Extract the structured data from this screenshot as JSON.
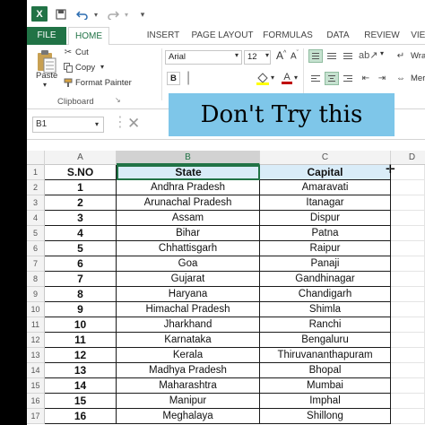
{
  "qat": {
    "logo": "X",
    "undo_icon": "undo-icon",
    "redo_icon": "redo-icon"
  },
  "tabs": [
    {
      "label": "FILE"
    },
    {
      "label": "HOME"
    },
    {
      "label": "INSERT"
    },
    {
      "label": "PAGE LAYOUT"
    },
    {
      "label": "FORMULAS"
    },
    {
      "label": "DATA"
    },
    {
      "label": "REVIEW"
    },
    {
      "label": "VIEW"
    }
  ],
  "ribbon": {
    "cut": "Cut",
    "copy": "Copy",
    "format_painter": "Format Painter",
    "paste": "Paste",
    "clipboard": "Clipboard",
    "font_name": "Arial",
    "font_size": "12",
    "bold": "B",
    "wrap_text": "Wrap Text",
    "merge": "Merge & C"
  },
  "formula_bar": {
    "name_box": "B1"
  },
  "overlay_text": "Don't Try this",
  "columns": [
    "A",
    "B",
    "C",
    "D"
  ],
  "header": {
    "sno": "S.NO",
    "state": "State",
    "capital": "Capital"
  },
  "rows": [
    {
      "n": "1",
      "sno": "1",
      "state": "Andhra Pradesh",
      "capital": "Amaravati"
    },
    {
      "n": "2",
      "sno": "2",
      "state": "Arunachal Pradesh",
      "capital": "Itanagar"
    },
    {
      "n": "3",
      "sno": "3",
      "state": "Assam",
      "capital": "Dispur"
    },
    {
      "n": "4",
      "sno": "4",
      "state": "Bihar",
      "capital": "Patna"
    },
    {
      "n": "5",
      "sno": "5",
      "state": "Chhattisgarh",
      "capital": "Raipur"
    },
    {
      "n": "6",
      "sno": "6",
      "state": "Goa",
      "capital": "Panaji"
    },
    {
      "n": "7",
      "sno": "7",
      "state": "Gujarat",
      "capital": "Gandhinagar"
    },
    {
      "n": "8",
      "sno": "8",
      "state": "Haryana",
      "capital": "Chandigarh"
    },
    {
      "n": "9",
      "sno": "9",
      "state": "Himachal Pradesh",
      "capital": "Shimla"
    },
    {
      "n": "10",
      "sno": "10",
      "state": "Jharkhand",
      "capital": "Ranchi"
    },
    {
      "n": "11",
      "sno": "11",
      "state": "Karnataka",
      "capital": "Bengaluru"
    },
    {
      "n": "12",
      "sno": "12",
      "state": "Kerala",
      "capital": "Thiruvananthapuram"
    },
    {
      "n": "13",
      "sno": "13",
      "state": "Madhya Pradesh",
      "capital": "Bhopal"
    },
    {
      "n": "14",
      "sno": "14",
      "state": "Maharashtra",
      "capital": "Mumbai"
    },
    {
      "n": "15",
      "sno": "15",
      "state": "Manipur",
      "capital": "Imphal"
    },
    {
      "n": "16",
      "sno": "16",
      "state": "Meghalaya",
      "capital": "Shillong"
    }
  ],
  "row_numbers": [
    "1",
    "2",
    "3",
    "4",
    "5",
    "6",
    "7",
    "8",
    "9",
    "10",
    "11",
    "12",
    "13",
    "14",
    "15",
    "16",
    "17"
  ],
  "colors": {
    "accent": "#217346",
    "header_fill": "#d9ecf8",
    "overlay": "#7ec6e9"
  }
}
